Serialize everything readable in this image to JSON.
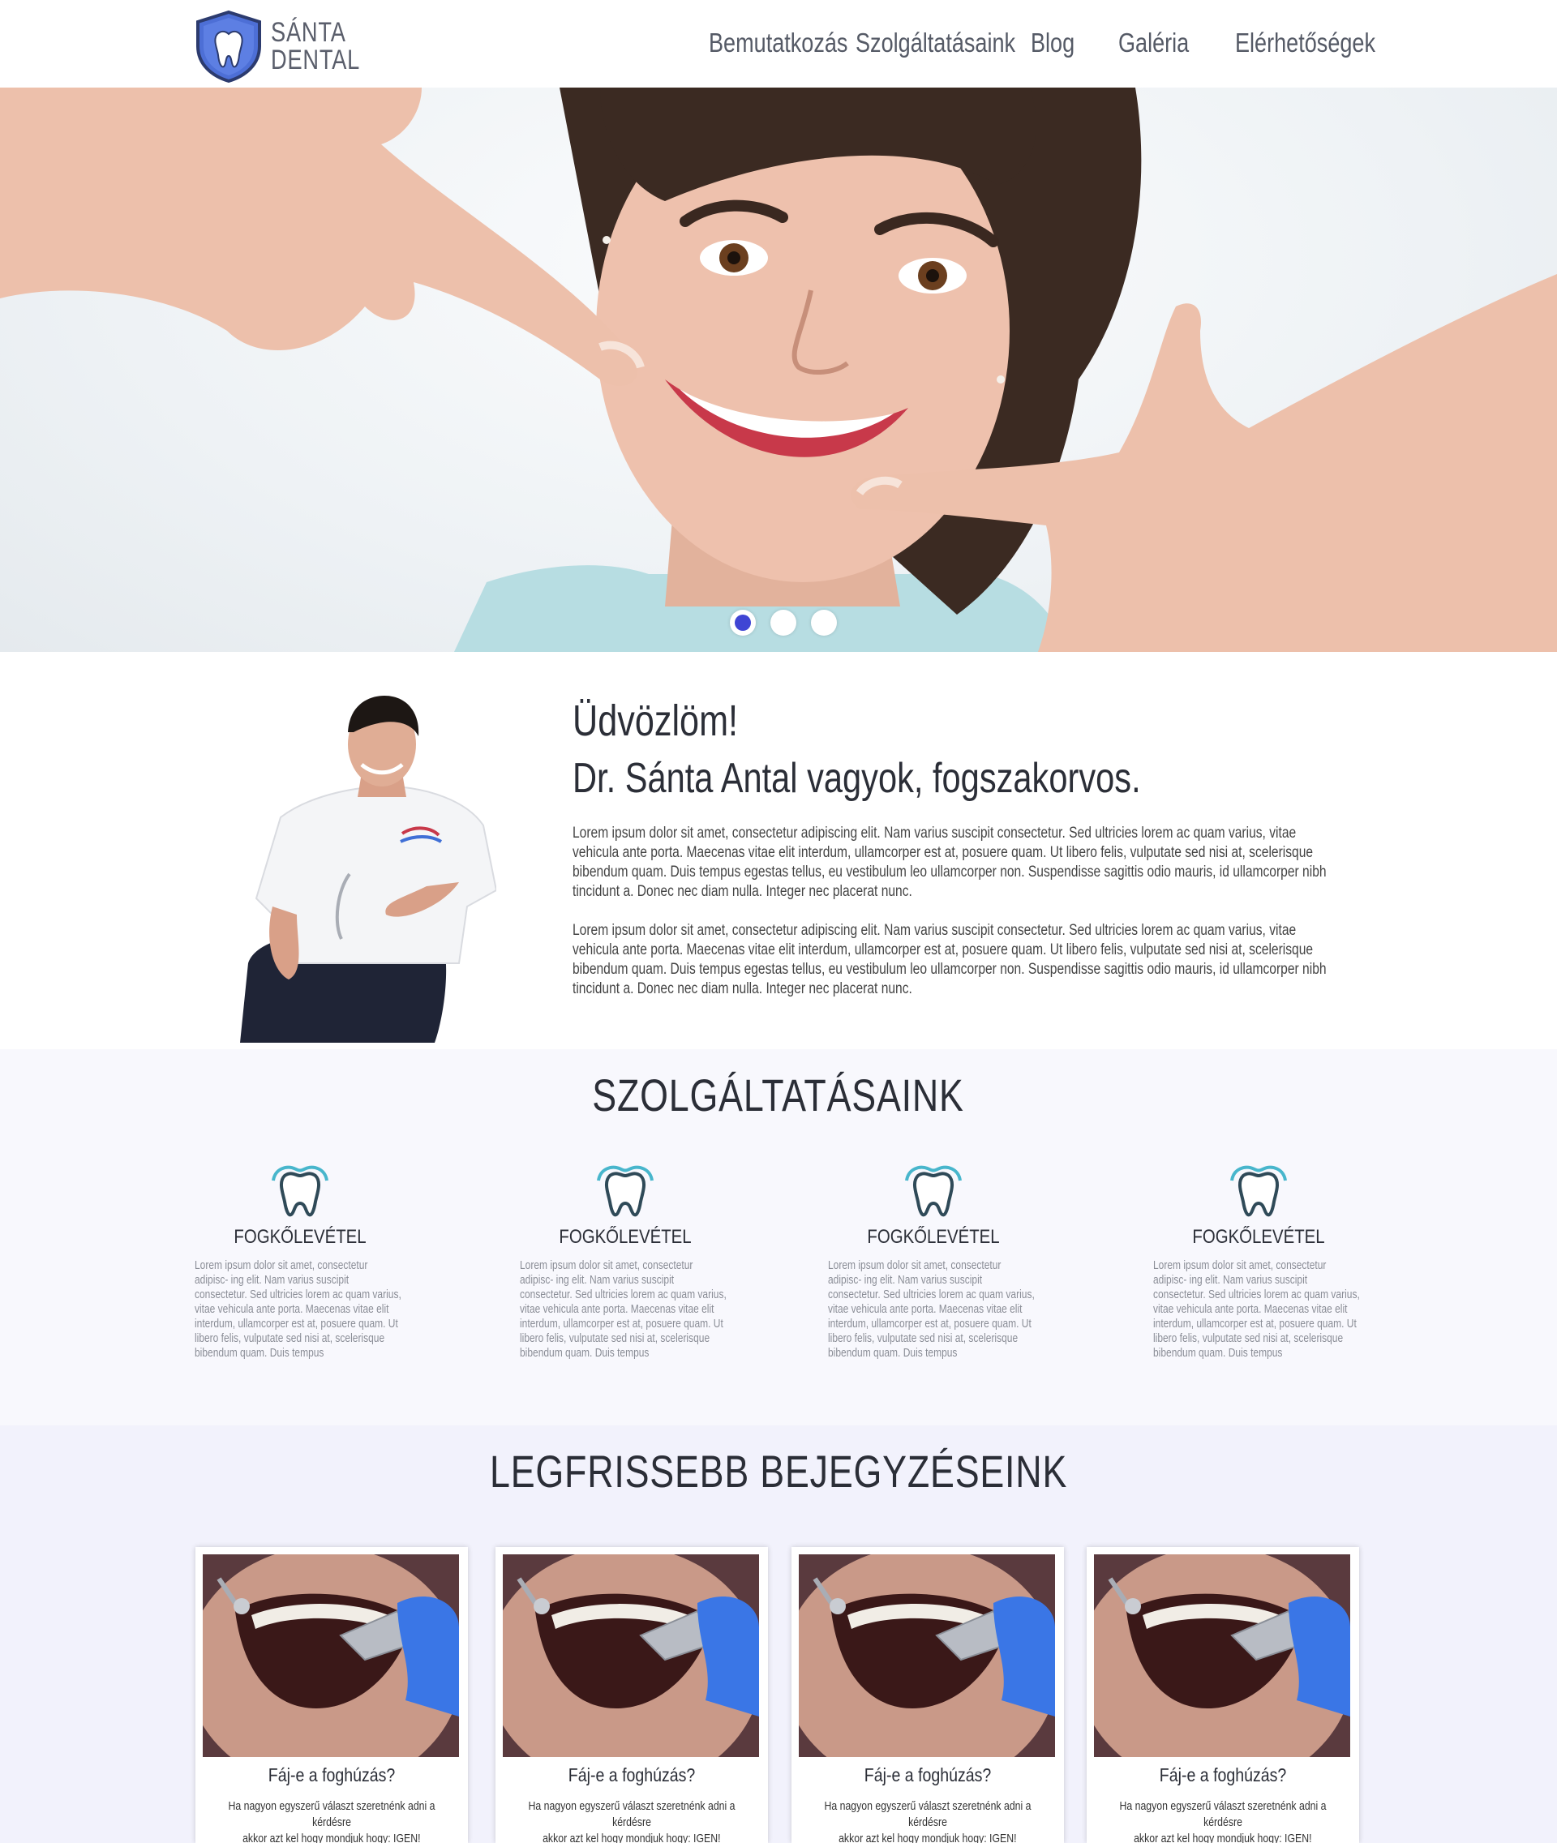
{
  "brand": {
    "line1": "SÁNTA",
    "line2": "DENTAL"
  },
  "nav": {
    "items": [
      {
        "label": "Bemutatkozás"
      },
      {
        "label": "Szolgáltatásaink"
      },
      {
        "label": "Blog"
      },
      {
        "label": "Galéria"
      },
      {
        "label": "Elérhetőségek"
      }
    ]
  },
  "hero": {
    "slides": 3,
    "active_slide": 1
  },
  "about": {
    "greeting": "Üdvözlöm!",
    "intro": "Dr. Sánta Antal vagyok, fogszakorvos.",
    "paragraphs": [
      "Lorem ipsum dolor sit amet, consectetur adipiscing elit. Nam varius suscipit consectetur. Sed ultricies lorem ac quam varius, vitae vehicula ante porta. Maecenas vitae elit interdum, ullamcorper est at, posuere quam. Ut libero felis, vulputate sed nisi at, scelerisque bibendum quam. Duis tempus egestas tellus, eu vestibulum leo ullamcorper non. Suspendisse sagittis odio mauris, id ullamcorper nibh tincidunt a. Donec nec diam nulla. Integer nec placerat nunc.",
      "Lorem ipsum dolor sit amet, consectetur adipiscing elit. Nam varius suscipit consectetur. Sed ultricies lorem ac quam varius, vitae vehicula ante porta. Maecenas vitae elit interdum, ullamcorper est at, posuere quam. Ut libero felis, vulputate sed nisi at, scelerisque bibendum quam. Duis tempus egestas tellus, eu vestibulum leo ullamcorper non. Suspendisse sagittis odio mauris, id ullamcorper nibh tincidunt a. Donec nec diam nulla. Integer nec placerat nunc."
    ]
  },
  "services": {
    "title": "SZOLGÁLTATÁSAINK",
    "items": [
      {
        "icon": "tooth-icon",
        "name": "FOGKŐLEVÉTEL",
        "text": "Lorem ipsum dolor sit amet, consectetur adipisc- ing elit. Nam varius suscipit consectetur. Sed ultricies lorem ac quam varius, vitae vehicula ante porta. Maecenas vitae elit interdum, ullamcorper est at, posuere quam. Ut libero felis, vulputate sed nisi at, scelerisque bibendum quam. Duis tempus"
      },
      {
        "icon": "tooth-icon",
        "name": "FOGKŐLEVÉTEL",
        "text": "Lorem ipsum dolor sit amet, consectetur adipisc- ing elit. Nam varius suscipit consectetur. Sed ultricies lorem ac quam varius, vitae vehicula ante porta. Maecenas vitae elit interdum, ullamcorper est at, posuere quam. Ut libero felis, vulputate sed nisi at, scelerisque bibendum quam. Duis tempus"
      },
      {
        "icon": "tooth-icon",
        "name": "FOGKŐLEVÉTEL",
        "text": "Lorem ipsum dolor sit amet, consectetur adipisc- ing elit. Nam varius suscipit consectetur. Sed ultricies lorem ac quam varius, vitae vehicula ante porta. Maecenas vitae elit interdum, ullamcorper est at, posuere quam. Ut libero felis, vulputate sed nisi at, scelerisque bibendum quam. Duis tempus"
      },
      {
        "icon": "tooth-icon",
        "name": "FOGKŐLEVÉTEL",
        "text": "Lorem ipsum dolor sit amet, consectetur adipisc- ing elit. Nam varius suscipit consectetur. Sed ultricies lorem ac quam varius, vitae vehicula ante porta. Maecenas vitae elit interdum, ullamcorper est at, posuere quam. Ut libero felis, vulputate sed nisi at, scelerisque bibendum quam. Duis tempus"
      }
    ]
  },
  "blog": {
    "title": "LEGFRISSEBB BEJEGYZÉSEINK",
    "posts": [
      {
        "title": "Fáj-e a foghúzás?",
        "line1": "Ha nagyon egyszerű választ szeretnénk adni a kérdésre",
        "line2": "akkor azt kel hogy mondjuk hogy: IGEN!"
      },
      {
        "title": "Fáj-e a foghúzás?",
        "line1": "Ha nagyon egyszerű választ szeretnénk adni a kérdésre",
        "line2": "akkor azt kel hogy mondjuk hogy: IGEN!"
      },
      {
        "title": "Fáj-e a foghúzás?",
        "line1": "Ha nagyon egyszerű választ szeretnénk adni a kérdésre",
        "line2": "akkor azt kel hogy mondjuk hogy: IGEN!"
      },
      {
        "title": "Fáj-e a foghúzás?",
        "line1": "Ha nagyon egyszerű választ szeretnénk adni a kérdésre",
        "line2": "akkor azt kel hogy mondjuk hogy: IGEN!"
      }
    ]
  },
  "colors": {
    "accent": "#3f45d4",
    "shield": "#4d6fd6",
    "tooth_icon": "#48b6cc",
    "text": "#2b2e37",
    "nav": "#555a66"
  }
}
